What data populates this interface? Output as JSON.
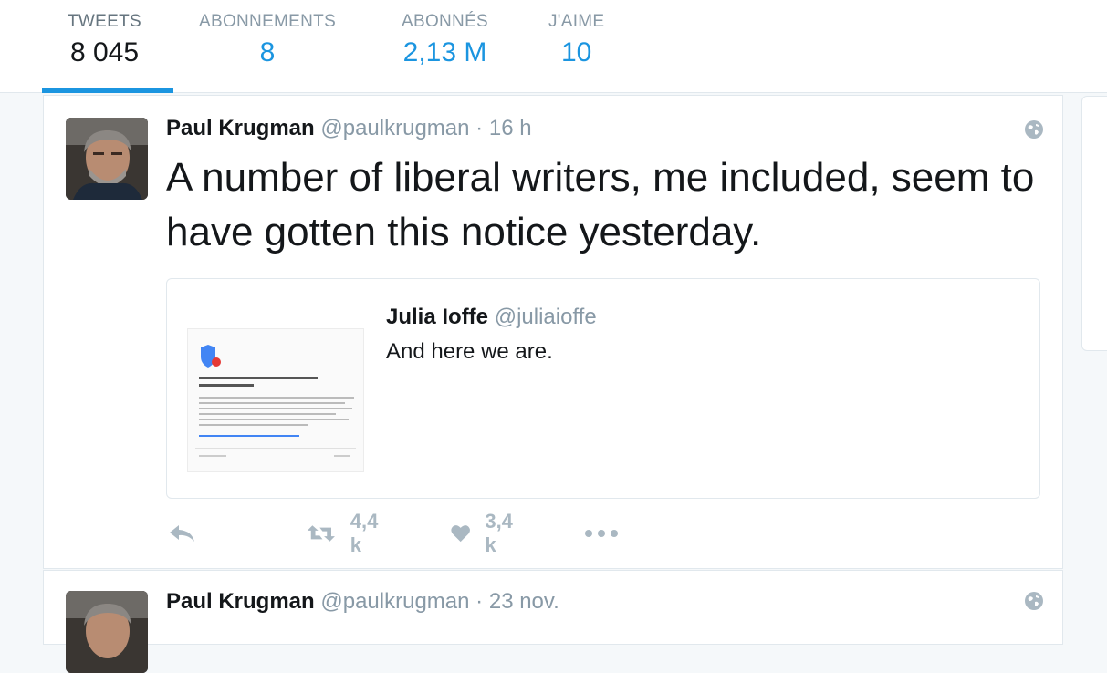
{
  "profile_nav": {
    "stats": [
      {
        "label": "TWEETS",
        "value": "8 045"
      },
      {
        "label": "ABONNEMENTS",
        "value": "8"
      },
      {
        "label": "ABONNÉS",
        "value": "2,13 M"
      },
      {
        "label": "J'AIME",
        "value": "10"
      }
    ]
  },
  "tweets": [
    {
      "name": "Paul Krugman",
      "handle": "@paulkrugman",
      "separator": "·",
      "time": "16 h",
      "text": "A number of liberal writers, me included, seem to have gotten this notice yesterday.",
      "quote": {
        "name": "Julia Ioffe",
        "handle": "@juliaioffe",
        "text": "And here we are."
      },
      "actions": {
        "retweets": "4,4 k",
        "likes": "3,4 k"
      }
    },
    {
      "name": "Paul Krugman",
      "handle": "@paulkrugman",
      "separator": "·",
      "time": "23 nov."
    }
  ],
  "icons": [
    "globe-icon",
    "reply-icon",
    "retweet-icon",
    "heart-icon",
    "more-icon"
  ],
  "colors": {
    "accent": "#1b95e0",
    "muted": "#8899a6",
    "action": "#aab8c2",
    "border": "#e1e8ed"
  }
}
